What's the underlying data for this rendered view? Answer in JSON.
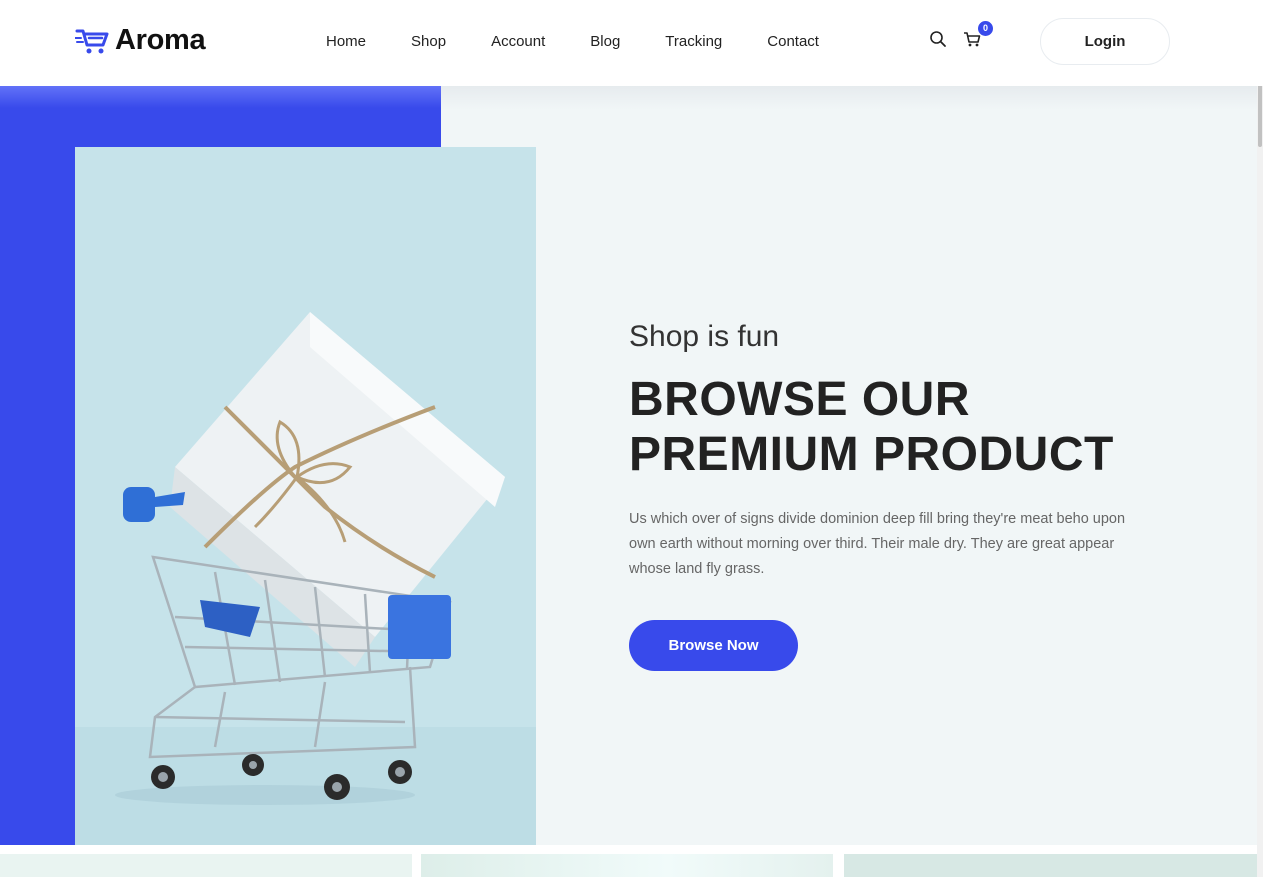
{
  "brand": {
    "name": "Aroma",
    "accent": "#384aeb"
  },
  "nav": {
    "items": [
      {
        "label": "Home"
      },
      {
        "label": "Shop"
      },
      {
        "label": "Account"
      },
      {
        "label": "Blog"
      },
      {
        "label": "Tracking"
      },
      {
        "label": "Contact"
      }
    ]
  },
  "header": {
    "search_icon": "search-icon",
    "cart_icon": "cart-icon",
    "cart_count": "0",
    "login_label": "Login"
  },
  "hero": {
    "subtitle": "Shop is fun",
    "title_line1": "BROWSE OUR",
    "title_line2": "PREMIUM PRODUCT",
    "text": "Us which over of signs divide dominion deep fill bring they're meat beho upon own earth without morning over third. Their male dry. They are great appear whose land fly grass.",
    "button_label": "Browse Now",
    "image": "shopping-cart-with-gift-box"
  }
}
